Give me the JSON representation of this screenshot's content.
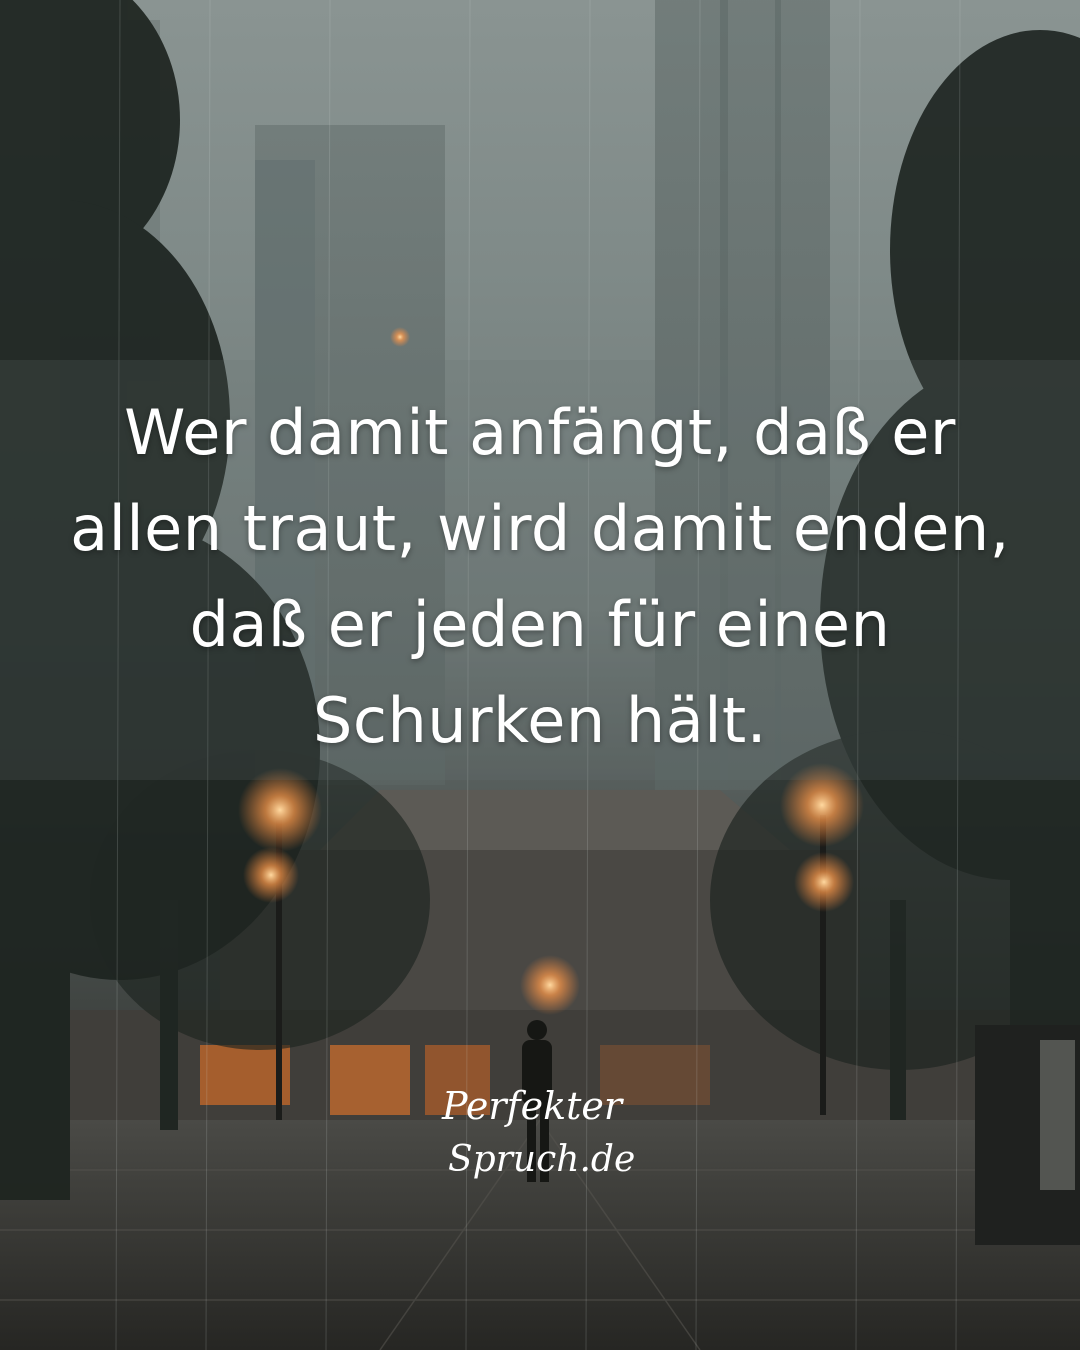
{
  "quote": {
    "lines": [
      "Wer damit anfängt, daß er",
      "allen traut, wird damit enden,",
      "daß er jeden für einen",
      "Schurken hält."
    ]
  },
  "logo": {
    "line1": "Perfekter",
    "line2": "Spruch.de"
  },
  "colors": {
    "text": "#ffffff",
    "lamp": "#ffb06a",
    "fog": "#7f8a88"
  }
}
